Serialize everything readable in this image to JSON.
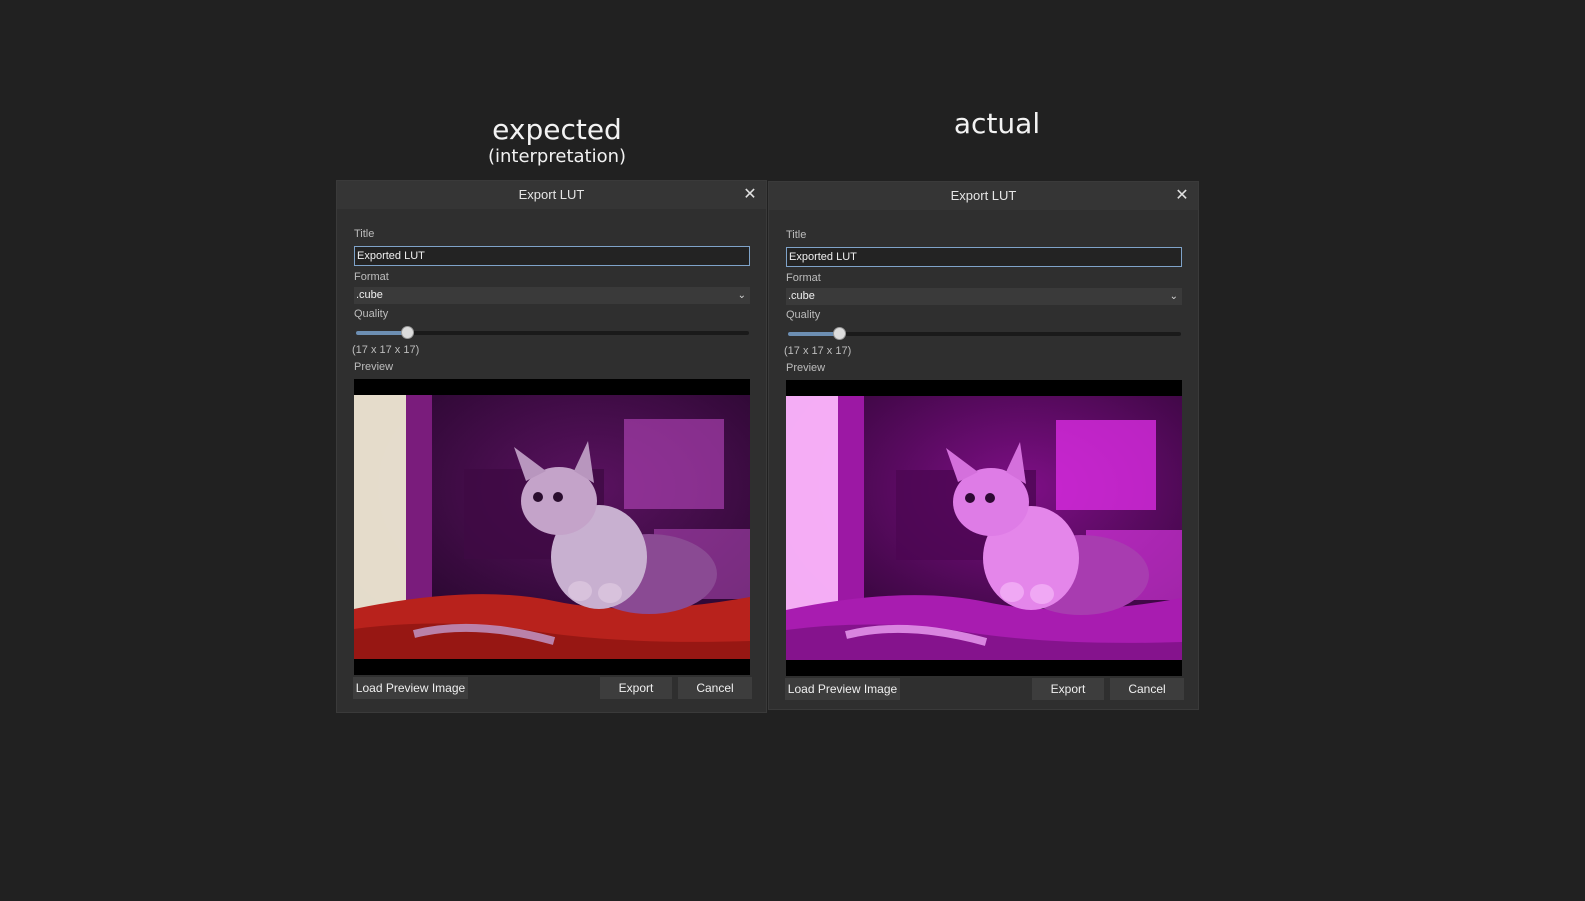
{
  "headings": {
    "expected": "expected",
    "expected_sub": "(interpretation)",
    "actual": "actual"
  },
  "dialogs": [
    {
      "id": "expected",
      "window_title": "Export LUT",
      "close_glyph": "✕",
      "title_label": "Title",
      "title_value": "Exported LUT",
      "format_label": "Format",
      "format_value": ".cube",
      "format_chevron": "⌄",
      "quality_label": "Quality",
      "quality_level": 0.13,
      "quality_readout": "(17 x 17 x 17)",
      "preview_label": "Preview",
      "preview_icon": "kitten-photo",
      "buttons": {
        "load": "Load Preview Image",
        "export": "Export",
        "cancel": "Cancel"
      },
      "tint": {
        "main": "#9a2fa0",
        "highlight": "#f0e6f2",
        "blanket": "#b8221c"
      }
    },
    {
      "id": "actual",
      "window_title": "Export LUT",
      "close_glyph": "✕",
      "title_label": "Title",
      "title_value": "Exported LUT",
      "format_label": "Format",
      "format_value": ".cube",
      "format_chevron": "⌄",
      "quality_label": "Quality",
      "quality_level": 0.13,
      "quality_readout": "(17 x 17 x 17)",
      "preview_label": "Preview",
      "preview_icon": "kitten-photo",
      "buttons": {
        "load": "Load Preview Image",
        "export": "Export",
        "cancel": "Cancel"
      },
      "tint": {
        "main": "#c21ec8",
        "highlight": "#ff9cff",
        "blanket": "#a81cb0"
      }
    }
  ]
}
